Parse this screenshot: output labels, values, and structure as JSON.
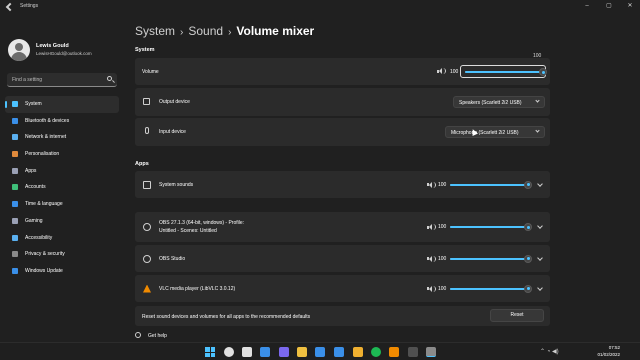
{
  "window": {
    "title": "Settings",
    "controls": {
      "minimize": "–",
      "maximize": "▢",
      "close": "✕"
    }
  },
  "user": {
    "name": "Lewis Gould",
    "email": "LewisHGould@outlook.com"
  },
  "search": {
    "placeholder": "Find a setting"
  },
  "nav": [
    {
      "label": "System",
      "icon": "system-icon",
      "color": "#4cc2ff",
      "active": true
    },
    {
      "label": "Bluetooth & devices",
      "icon": "bluetooth-icon",
      "color": "#3a8fe8"
    },
    {
      "label": "Network & internet",
      "icon": "wifi-icon",
      "color": "#5ab0f0"
    },
    {
      "label": "Personalisation",
      "icon": "brush-icon",
      "color": "#e08a3c"
    },
    {
      "label": "Apps",
      "icon": "apps-icon",
      "color": "#9aa0b5"
    },
    {
      "label": "Accounts",
      "icon": "person-icon",
      "color": "#3fc07a"
    },
    {
      "label": "Time & language",
      "icon": "globe-clock-icon",
      "color": "#3a8fe8"
    },
    {
      "label": "Gaming",
      "icon": "controller-icon",
      "color": "#9aa0b5"
    },
    {
      "label": "Accessibility",
      "icon": "accessibility-icon",
      "color": "#5ab0f0"
    },
    {
      "label": "Privacy & security",
      "icon": "shield-icon",
      "color": "#8a8a8a"
    },
    {
      "label": "Windows Update",
      "icon": "update-icon",
      "color": "#3a8fe8"
    }
  ],
  "breadcrumb": {
    "part1": "System",
    "sep1": "›",
    "part2": "Sound",
    "sep2": "›",
    "current": "Volume mixer"
  },
  "system_section": {
    "heading": "System",
    "volume": {
      "label": "Volume",
      "value": "100",
      "tooltip": "100",
      "level": 1.0
    },
    "output": {
      "label": "Output device",
      "selected": "Speakers (Scarlett 2i2 USB)"
    },
    "input": {
      "label": "Input device",
      "selected": "Microphone (Scarlett 2i2 USB)"
    }
  },
  "apps_section": {
    "heading": "Apps",
    "apps": [
      {
        "name": "System sounds",
        "volume": "100",
        "level": 1.0,
        "muted_icon": true
      },
      {
        "name": "OBS 27.1.3 (64-bit, windows) - Profile:",
        "name2": "Untitled - Scenes: Untitled",
        "volume": "100",
        "level": 1.0
      },
      {
        "name": "OBS Studio",
        "volume": "100",
        "level": 1.0
      },
      {
        "name": "VLC media player (LibVLC 3.0.12)",
        "volume": "100",
        "level": 1.0
      }
    ],
    "reset": {
      "text": "Reset sound devices and volumes for all apps to the recommended defaults",
      "button": "Reset"
    }
  },
  "help": {
    "label": "Get help"
  },
  "taskbar": {
    "icons": [
      "search-icon",
      "task-view-icon",
      "widgets-icon",
      "chat-icon",
      "file-explorer-icon",
      "store-icon",
      "mail-icon",
      "chrome-icon",
      "spotify-icon",
      "vlc-icon",
      "obs-icon",
      "settings-icon"
    ],
    "icon_colors": [
      "#e0e0e0",
      "#e0e0e0",
      "#3a8fe8",
      "#7b68ee",
      "#f0c040",
      "#3a8fe8",
      "#3a8fe8",
      "#f0b030",
      "#1db954",
      "#f08a00",
      "#505050",
      "#8a8a8a"
    ],
    "time": "07:52",
    "date": "01/02/2022",
    "tray": "⌃ ◔ ◀)"
  }
}
